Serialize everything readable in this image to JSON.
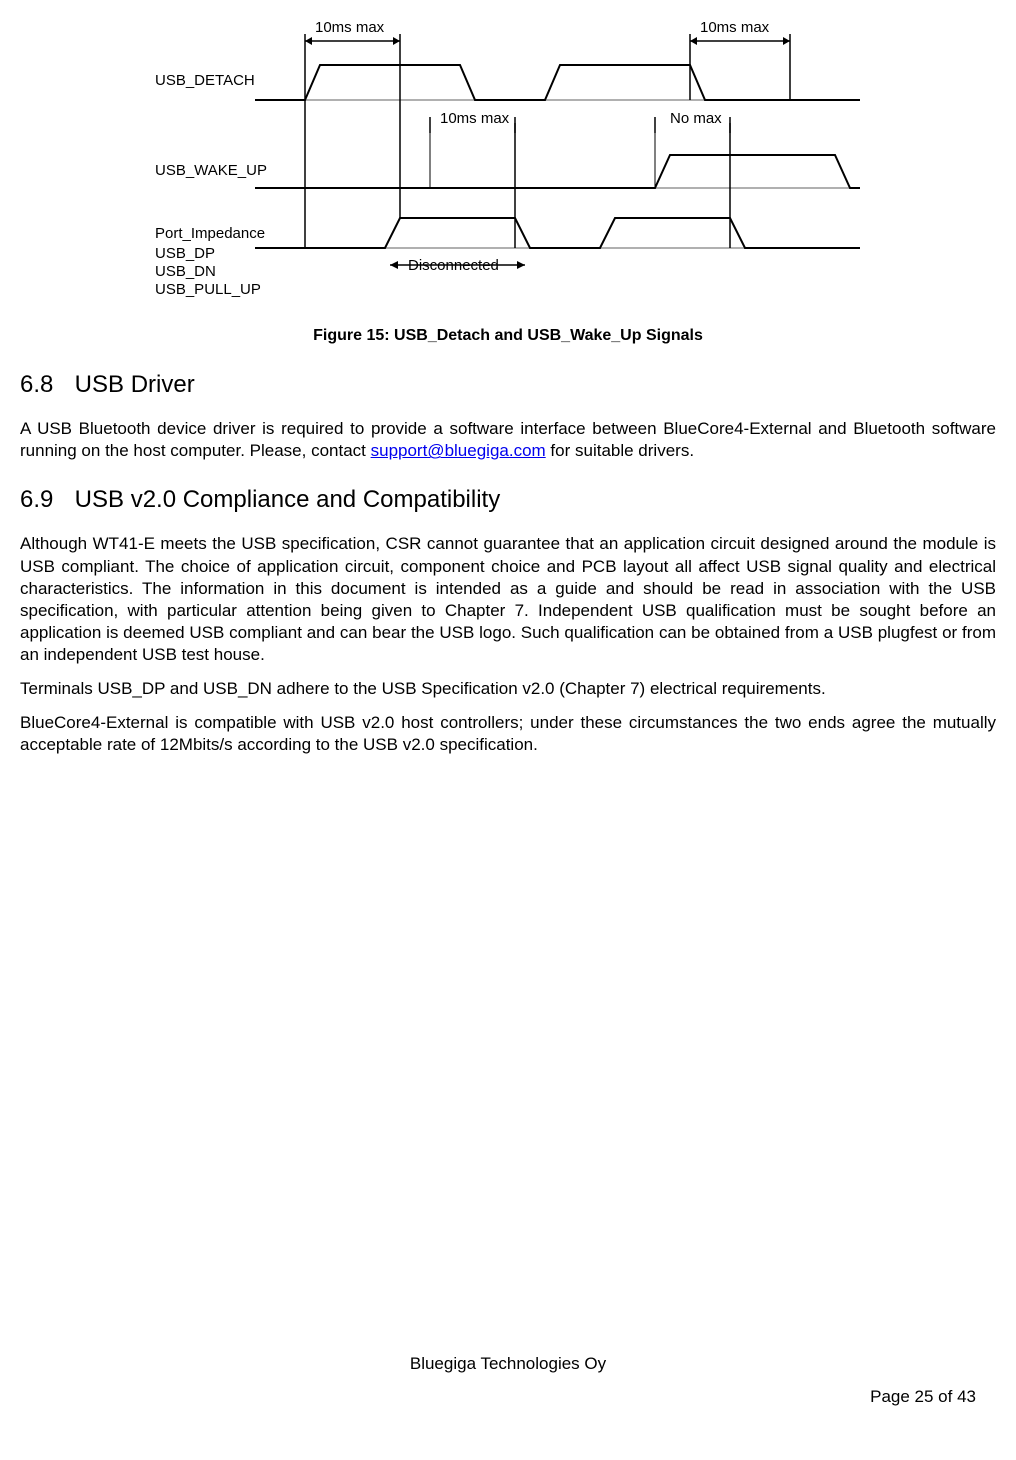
{
  "diagram": {
    "labels": {
      "usb_detach": "USB_DETACH",
      "usb_wake_up": "USB_WAKE_UP",
      "port_impedance": "Port_Impedance",
      "usb_dp": "USB_DP",
      "usb_dn": "USB_DN",
      "usb_pull_up": "USB_PULL_UP",
      "ten_ms_max_top_left": "10ms max",
      "ten_ms_max_top_right": "10ms max",
      "ten_ms_max_mid": "10ms max",
      "no_max": "No max",
      "disconnected": "Disconnected"
    }
  },
  "figure_caption": "Figure 15: USB_Detach and USB_Wake_Up Signals",
  "sections": {
    "s68": {
      "num": "6.8",
      "title": "USB Driver",
      "p1a": "A USB Bluetooth device driver is required to provide a software interface between BlueCore4-External and Bluetooth software running on the host computer. Please, contact ",
      "link": "support@bluegiga.com",
      "p1b": " for suitable drivers."
    },
    "s69": {
      "num": "6.9",
      "title": "USB v2.0 Compliance and Compatibility",
      "p1": "Although WT41-E meets the USB specification, CSR cannot guarantee that an application circuit designed around the module is USB compliant. The choice of application circuit, component choice and PCB layout all affect USB signal quality and electrical characteristics. The information in this document is intended as a guide and should be read in association with the USB specification, with particular attention being given to Chapter 7. Independent USB qualification must be sought before an application is deemed USB compliant and can bear the USB logo. Such qualification can be obtained from a USB plugfest or from an independent USB test house.",
      "p2": "Terminals USB_DP and USB_DN adhere to the USB Specification v2.0 (Chapter 7) electrical requirements.",
      "p3": "BlueCore4-External is compatible with USB v2.0 host controllers; under these circumstances the two ends agree the mutually acceptable rate of 12Mbits/s according to the USB v2.0 specification."
    }
  },
  "footer": {
    "company": "Bluegiga Technologies Oy",
    "page": "Page 25 of 43"
  }
}
